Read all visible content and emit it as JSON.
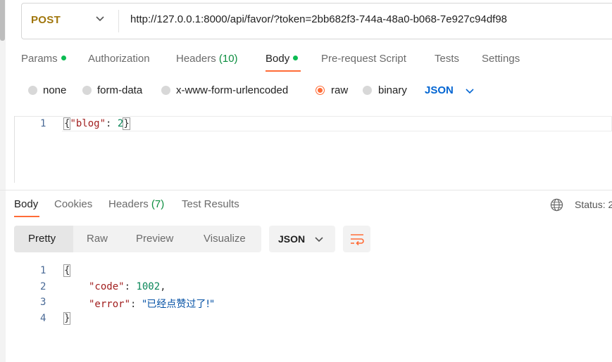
{
  "request": {
    "method": "POST",
    "url": "http://127.0.0.1:8000/api/favor/?token=2bb682f3-744a-48a0-b068-7e927c94df98"
  },
  "request_tabs": [
    {
      "label": "Params",
      "dot": true
    },
    {
      "label": "Authorization"
    },
    {
      "label": "Headers",
      "count": "(10)"
    },
    {
      "label": "Body",
      "dot": true,
      "active": true
    },
    {
      "label": "Pre-request Script"
    },
    {
      "label": "Tests"
    },
    {
      "label": "Settings"
    }
  ],
  "body_types": [
    "none",
    "form-data",
    "x-www-form-urlencoded",
    "raw",
    "binary"
  ],
  "selected_body_type": "raw",
  "raw_format": "JSON",
  "request_body": {
    "line_number": "1",
    "open": "{",
    "key": "\"blog\"",
    "colon": ": ",
    "value": "2",
    "close": "}"
  },
  "response_tabs": [
    {
      "label": "Body",
      "active": true
    },
    {
      "label": "Cookies"
    },
    {
      "label": "Headers",
      "count": "(7)"
    },
    {
      "label": "Test Results"
    }
  ],
  "status_label": "Status: 2",
  "view_modes": [
    "Pretty",
    "Raw",
    "Preview",
    "Visualize"
  ],
  "active_view_mode": "Pretty",
  "response_format": "JSON",
  "response_body": {
    "line_numbers": [
      "1",
      "2",
      "3",
      "4"
    ],
    "open": "{",
    "code_key": "\"code\"",
    "code_value": "1002",
    "error_key": "\"error\"",
    "error_value": "\"已经点赞过了!\"",
    "close": "}"
  },
  "colors": {
    "accent": "#ff6c37",
    "method": "#a0760c",
    "json_blue": "#0265d2",
    "green": "#0cbb52"
  }
}
